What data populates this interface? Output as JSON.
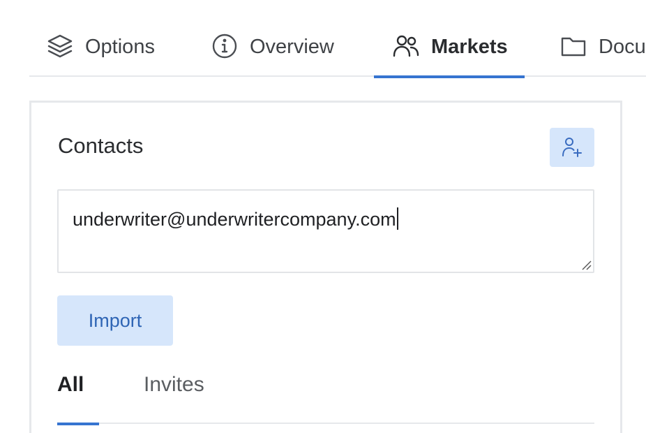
{
  "tabs": [
    {
      "label": "Options",
      "icon": "layers-icon"
    },
    {
      "label": "Overview",
      "icon": "info-circle-icon"
    },
    {
      "label": "Markets",
      "icon": "users-icon",
      "active": true
    },
    {
      "label": "Docu",
      "icon": "folder-icon"
    }
  ],
  "contacts": {
    "title": "Contacts",
    "add_icon": "user-plus-icon",
    "textarea_value": "underwriter@underwritercompany.com",
    "import_label": "Import"
  },
  "subtabs": [
    {
      "label": "All",
      "active": true
    },
    {
      "label": "Invites"
    }
  ],
  "colors": {
    "accent": "#3674d0",
    "button_bg": "#d6e6fb",
    "button_text": "#2f65b5",
    "border": "#e6e8eb"
  }
}
